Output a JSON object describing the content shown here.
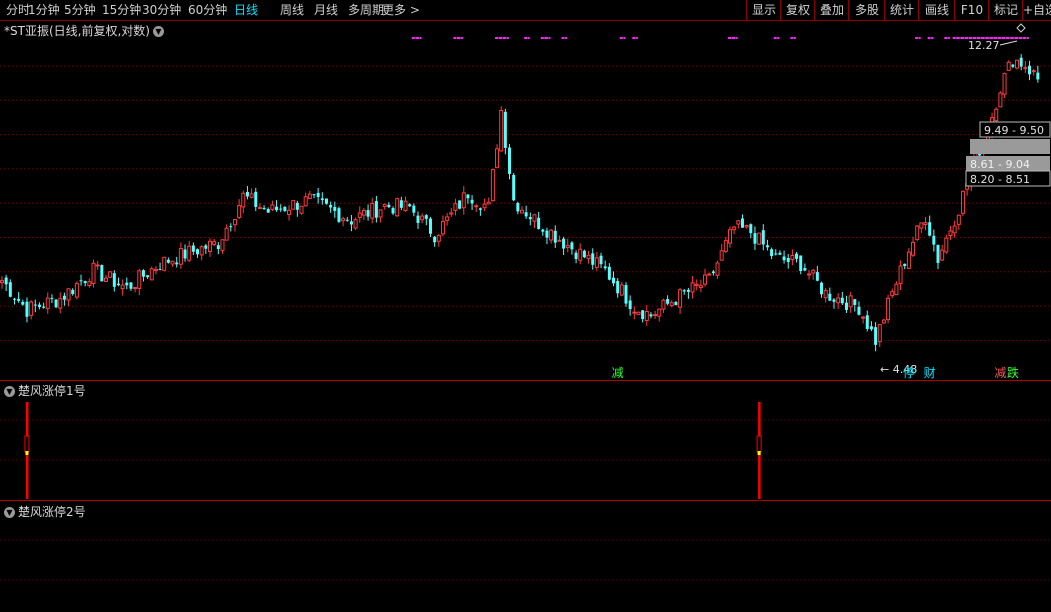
{
  "toolbar": {
    "periods": [
      "分时",
      "1分钟",
      "5分钟",
      "15分钟",
      "30分钟",
      "60分钟",
      "日线",
      "周线",
      "月线",
      "多周期",
      "更多 >"
    ],
    "active_period": "日线",
    "tools": [
      "显示",
      "复权",
      "叠加",
      "多股",
      "统计",
      "画线",
      "F10",
      "标记",
      "+自选"
    ]
  },
  "main_pane": {
    "title": "*ST亚振(日线,前复权,对数)"
  },
  "sub_panes": [
    {
      "title": "楚风涨停1号"
    },
    {
      "title": "楚风涨停2号"
    }
  ],
  "colors": {
    "up": "#ff3b3b",
    "down": "#54ffff",
    "grid": "#8b0000",
    "marker": "#ff22ff",
    "white_dash": "#ffffff"
  },
  "icons": {
    "collapse": "chevron-down-icon",
    "diamond": "diamond-icon"
  },
  "chart_data": {
    "type": "candlestick",
    "y_scale": "log",
    "ylim": [
      4.0,
      13.6
    ],
    "max_label": "12.27",
    "min_label": "← 4.48",
    "price_boxes": [
      {
        "label": "9.49 - 9.50",
        "style": "outline"
      },
      {
        "label": "",
        "style": "filled"
      },
      {
        "label": "8.61 - 9.04",
        "style": "filled"
      },
      {
        "label": "8.20 - 8.51",
        "style": "outline"
      }
    ],
    "event_tags": [
      {
        "label": "减",
        "index": 148,
        "color": "#33ff33"
      },
      {
        "label": "停",
        "index": 218,
        "color": "#00e5ff"
      },
      {
        "label": "财",
        "index": 223,
        "color": "#00e5ff"
      },
      {
        "label": "减",
        "index": 240,
        "color": "#ff5555"
      },
      {
        "label": "跌",
        "index": 243,
        "color": "#33ff33"
      }
    ],
    "markers_top": [
      99,
      100,
      109,
      110,
      119,
      120,
      121,
      126,
      130,
      131,
      135,
      149,
      152,
      175,
      176,
      186,
      190,
      220,
      223,
      227,
      229,
      230,
      231,
      232,
      233,
      234,
      235,
      236,
      237,
      238,
      239,
      240,
      241,
      242,
      243,
      244,
      245,
      246
    ],
    "anchors": [
      [
        0,
        5.55
      ],
      [
        6,
        5.0
      ],
      [
        14,
        5.2
      ],
      [
        22,
        5.75
      ],
      [
        30,
        5.4
      ],
      [
        38,
        5.9
      ],
      [
        44,
        6.1
      ],
      [
        52,
        6.35
      ],
      [
        58,
        7.5
      ],
      [
        64,
        7.1
      ],
      [
        74,
        7.4
      ],
      [
        84,
        6.9
      ],
      [
        92,
        7.25
      ],
      [
        98,
        7.2
      ],
      [
        104,
        6.55
      ],
      [
        108,
        7.0
      ],
      [
        112,
        7.6
      ],
      [
        117,
        7.2
      ],
      [
        120,
        10.2
      ],
      [
        123,
        7.4
      ],
      [
        128,
        6.9
      ],
      [
        136,
        6.3
      ],
      [
        145,
        5.75
      ],
      [
        152,
        5.05
      ],
      [
        156,
        4.9
      ],
      [
        162,
        5.2
      ],
      [
        170,
        5.55
      ],
      [
        176,
        6.7
      ],
      [
        180,
        6.6
      ],
      [
        186,
        6.0
      ],
      [
        192,
        5.9
      ],
      [
        198,
        5.3
      ],
      [
        206,
        5.05
      ],
      [
        210,
        4.48
      ],
      [
        214,
        5.3
      ],
      [
        218,
        6.2
      ],
      [
        222,
        7.0
      ],
      [
        225,
        6.0
      ],
      [
        230,
        7.2
      ],
      [
        234,
        8.6
      ],
      [
        237,
        9.5
      ],
      [
        240,
        11.1
      ],
      [
        243,
        12.27
      ],
      [
        246,
        12.0
      ],
      [
        249,
        11.4
      ]
    ],
    "indicator_1": {
      "signal_indices": [
        6,
        182
      ],
      "color": "#ff0000",
      "mid_color": "#ffff00"
    },
    "indicator_2": {
      "signal_indices": []
    }
  }
}
